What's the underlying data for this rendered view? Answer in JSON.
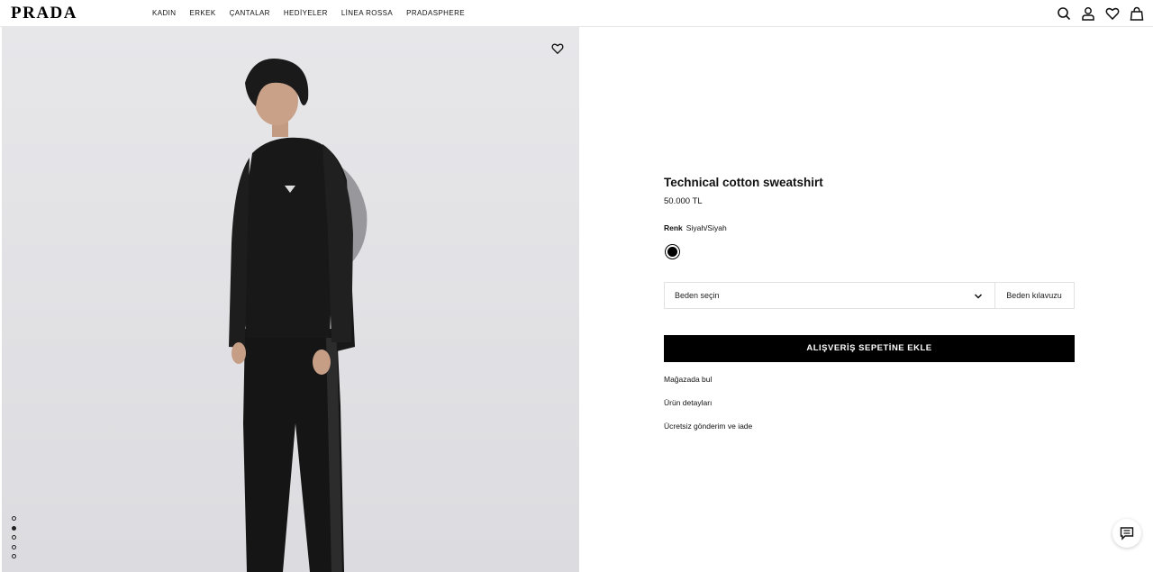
{
  "brand": "PRADA",
  "nav": {
    "items": [
      "KADIN",
      "ERKEK",
      "ÇANTALAR",
      "HEDİYELER",
      "LİNEA ROSSA",
      "PRADASPHERE"
    ]
  },
  "header_icons": [
    "search-icon",
    "account-icon",
    "wishlist-icon",
    "bag-icon"
  ],
  "gallery": {
    "dot_count": 5,
    "active_index": 1
  },
  "product": {
    "title": "Technical cotton sweatshirt",
    "price": "50.000 TL",
    "color_label": "Renk",
    "color_value": "Siyah/Siyah",
    "swatch_color": "#000000",
    "size_placeholder": "Beden seçin",
    "size_guide": "Beden kılavuzu",
    "add_to_cart": "ALIŞVERİŞ SEPETİNE EKLE",
    "links": [
      "Mağazada bul",
      "Ürün detayları",
      "Ücretsiz gönderim ve iade"
    ]
  }
}
